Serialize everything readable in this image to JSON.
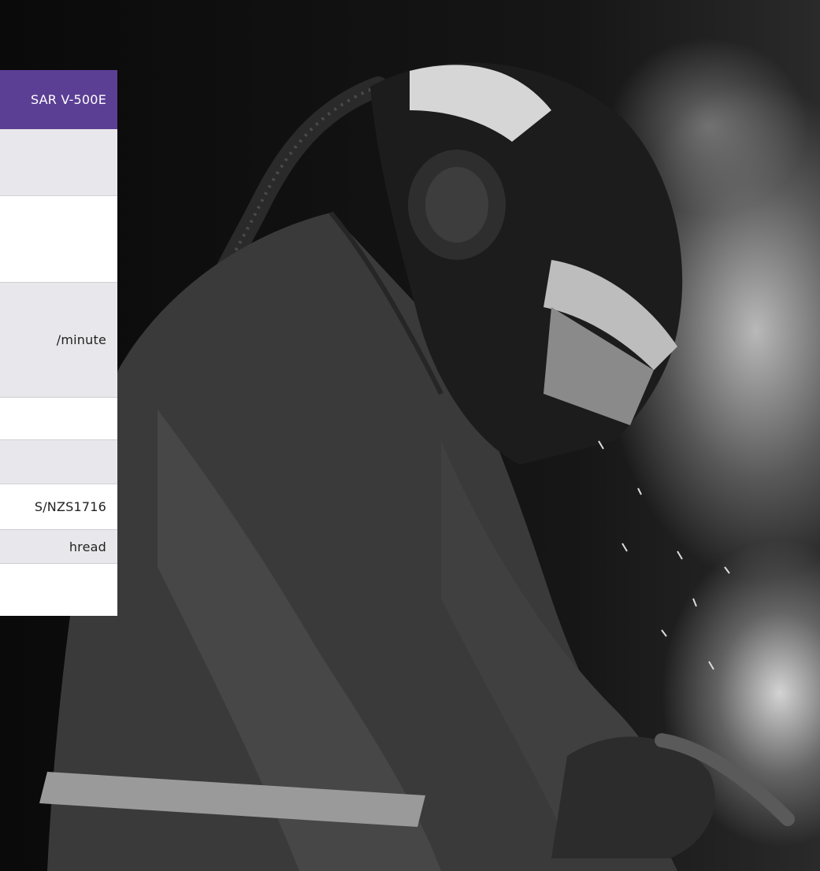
{
  "spec_table": {
    "header": "SAR V-500E",
    "rows": [
      {
        "value": ""
      },
      {
        "value": ""
      },
      {
        "value": "/minute"
      },
      {
        "value": ""
      },
      {
        "value": ""
      },
      {
        "value": "S/NZS1716"
      },
      {
        "value": "hread"
      },
      {
        "value": ""
      }
    ]
  },
  "colors": {
    "header_bg": "#5b3f94",
    "row_alt_bg": "#e8e8ec",
    "row_plain_bg": "#ffffff"
  }
}
